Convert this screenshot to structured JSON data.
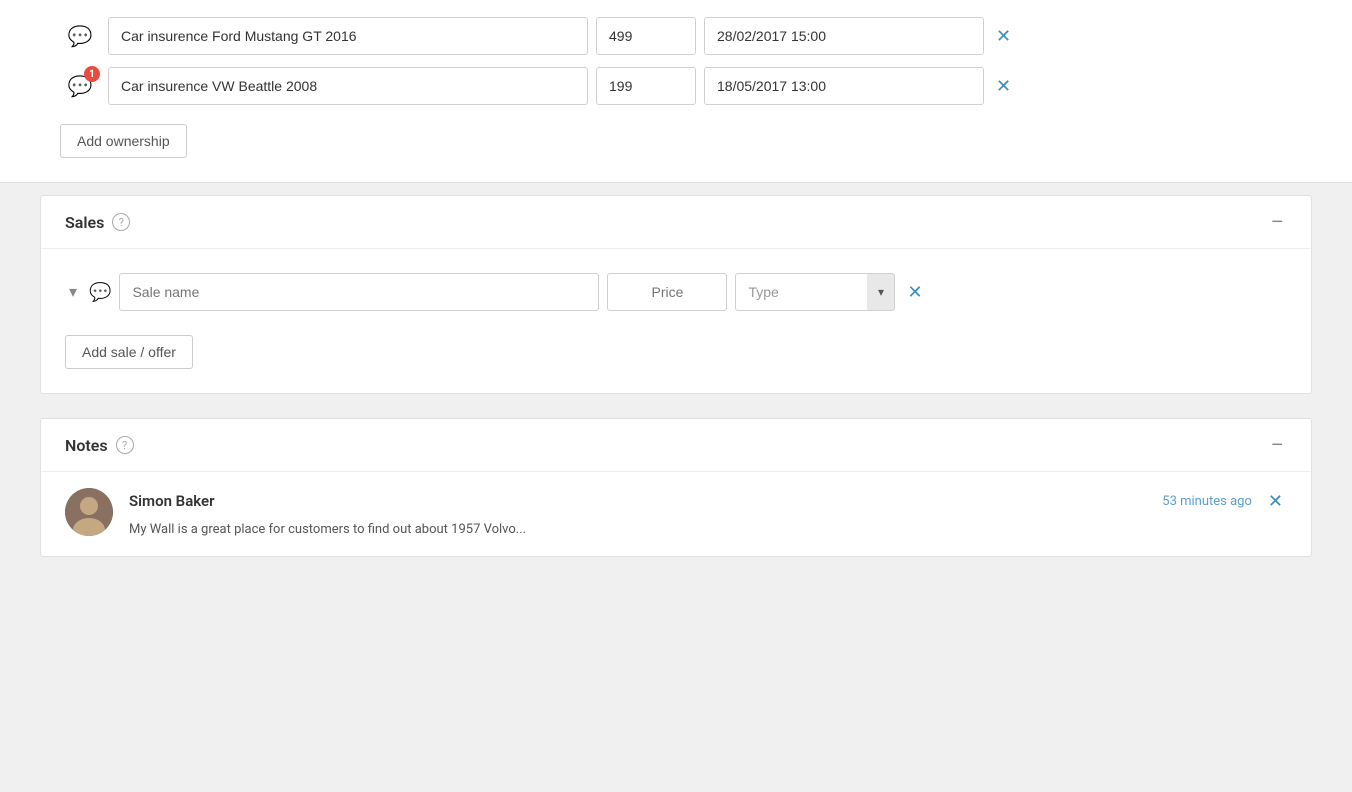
{
  "ownership": {
    "rows": [
      {
        "id": 1,
        "name": "Car insurence Ford Mustang GT 2016",
        "price": "499",
        "date": "28/02/2017 15:00",
        "has_badge": false,
        "badge_count": null
      },
      {
        "id": 2,
        "name": "Car insurence VW Beattle 2008",
        "price": "199",
        "date": "18/05/2017 13:00",
        "has_badge": true,
        "badge_count": "1"
      }
    ],
    "add_button_label": "Add ownership"
  },
  "sales": {
    "title": "Sales",
    "help_tooltip": "?",
    "collapse_icon": "−",
    "row": {
      "sale_name_placeholder": "Sale name",
      "price_placeholder": "Price",
      "type_placeholder": "Type"
    },
    "add_button_label": "Add sale / offer"
  },
  "notes": {
    "title": "Notes",
    "help_tooltip": "?",
    "collapse_icon": "−",
    "note": {
      "author": "Simon Baker",
      "time_ago": "53 minutes ago",
      "text": "My Wall is a great place for customers to find out about 1957 Volvo..."
    }
  }
}
